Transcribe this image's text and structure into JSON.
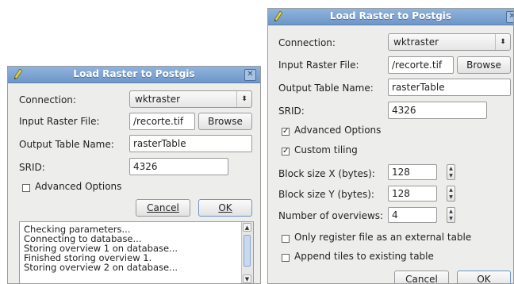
{
  "left_dialog": {
    "title": "Load Raster to Postgis",
    "connection_label": "Connection:",
    "connection_value": "wktraster",
    "input_raster_label": "Input Raster File:",
    "input_raster_value": "/recorte.tif",
    "browse_label": "Browse",
    "output_table_label": "Output Table Name:",
    "output_table_value": "rasterTable",
    "srid_label": "SRID:",
    "srid_value": "4326",
    "advanced_options_label": "Advanced Options",
    "advanced_options_checked": false,
    "cancel_label": "Cancel",
    "ok_label": "OK",
    "log_lines": [
      "Checking parameters...",
      "Connecting to database...",
      "Storing overview 1 on database...",
      "Finished storing overview 1.",
      "Storing overview 2 on database..."
    ]
  },
  "right_dialog": {
    "title": "Load Raster to Postgis",
    "connection_label": "Connection:",
    "connection_value": "wktraster",
    "input_raster_label": "Input Raster File:",
    "input_raster_value": "/recorte.tif",
    "browse_label": "Browse",
    "output_table_label": "Output Table Name:",
    "output_table_value": "rasterTable",
    "srid_label": "SRID:",
    "srid_value": "4326",
    "advanced_options_label": "Advanced Options",
    "advanced_options_checked": true,
    "custom_tiling_label": "Custom tiling",
    "custom_tiling_checked": true,
    "block_x_label": "Block size X (bytes):",
    "block_x_value": "128",
    "block_y_label": "Block size Y (bytes):",
    "block_y_value": "128",
    "overviews_label": "Number of overviews:",
    "overviews_value": "4",
    "register_external_label": "Only register file as an external table",
    "register_external_checked": false,
    "append_tiles_label": "Append tiles to existing table",
    "append_tiles_checked": false,
    "cancel_label": "Cancel",
    "ok_label": "OK"
  },
  "icons": {
    "app": "pencil-icon",
    "close": "close-icon",
    "combo_arrow": "up-down-arrows-icon",
    "check": "checkmark-icon"
  },
  "colors": {
    "titlebar": "#7fa4d3",
    "dialog_bg": "#ededec",
    "field_bg": "#ffffff"
  }
}
